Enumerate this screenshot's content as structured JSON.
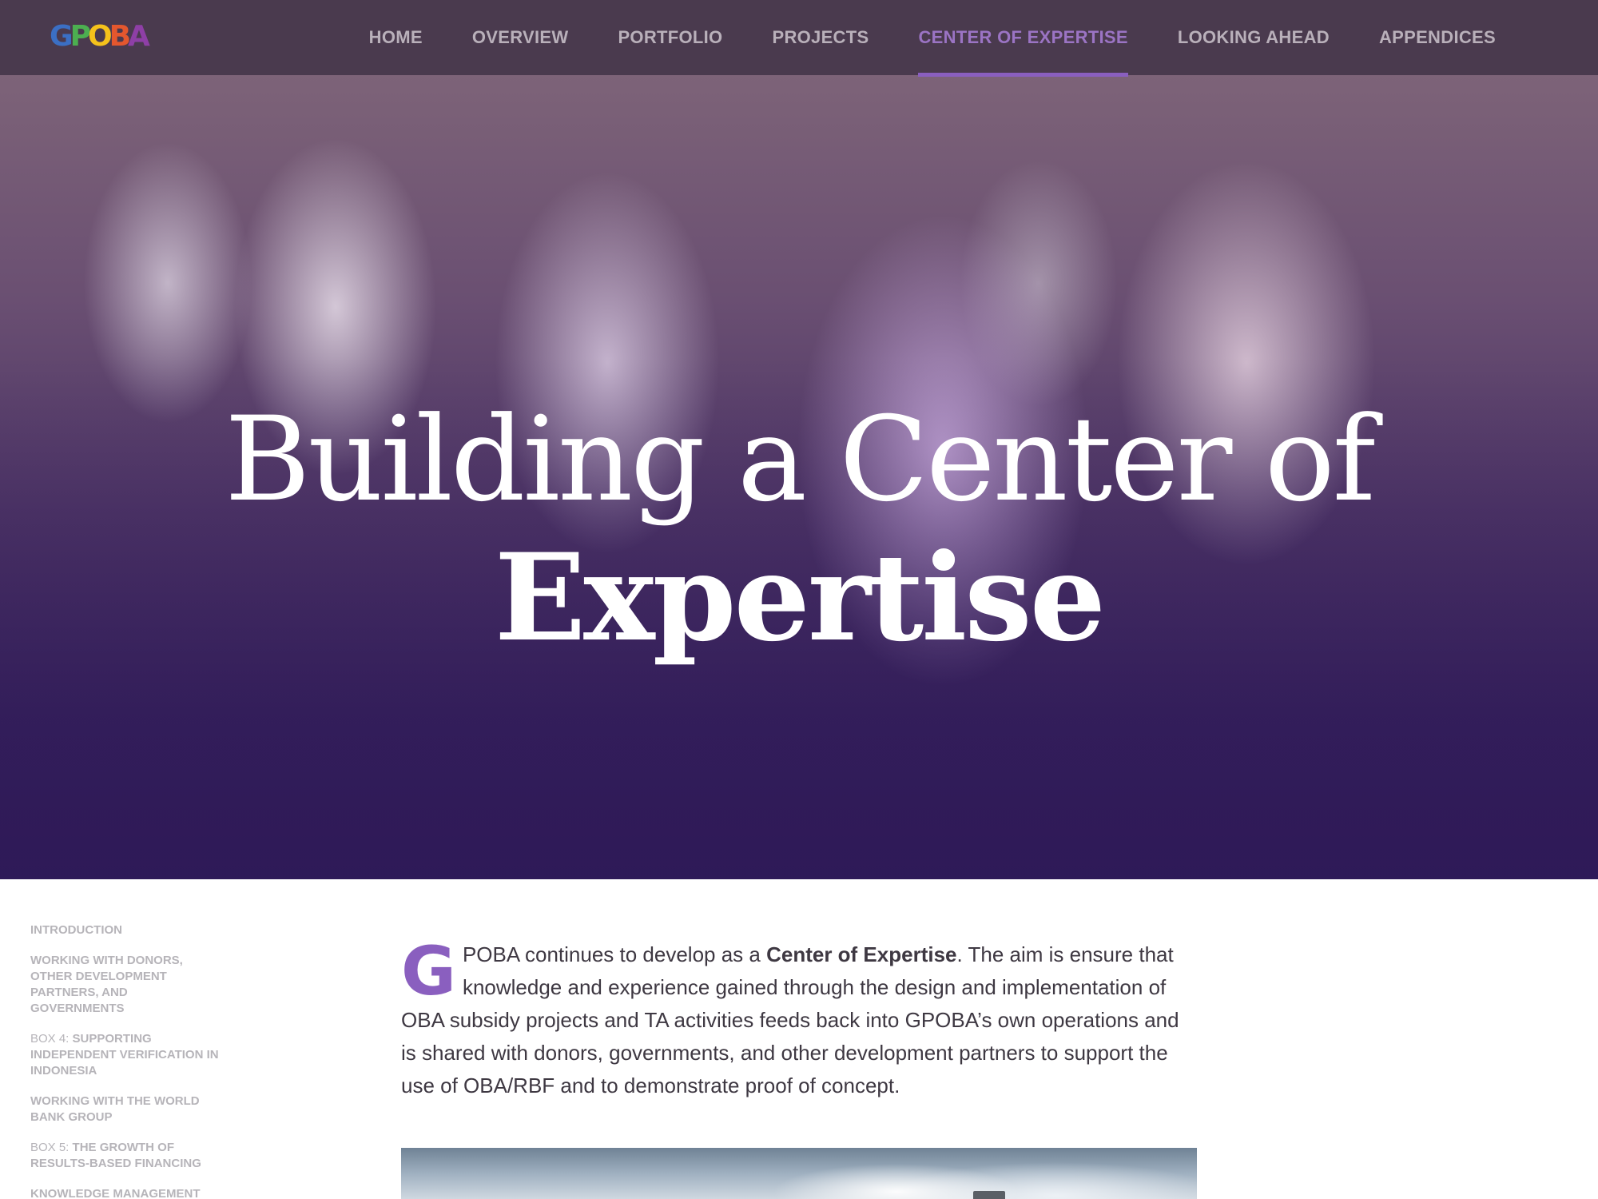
{
  "nav": {
    "logo_text": "GPOBA",
    "logo_letters": [
      {
        "char": "G",
        "color": "#3b6fc4"
      },
      {
        "char": "P",
        "color": "#4caf50"
      },
      {
        "char": "O",
        "color": "#f5c21b"
      },
      {
        "char": "B",
        "color": "#e4572e"
      },
      {
        "char": "A",
        "color": "#8e3fa6"
      }
    ],
    "items": [
      {
        "label": "HOME"
      },
      {
        "label": "OVERVIEW"
      },
      {
        "label": "PORTFOLIO"
      },
      {
        "label": "PROJECTS"
      },
      {
        "label": "CENTER OF EXPERTISE",
        "active": true
      },
      {
        "label": "LOOKING AHEAD"
      },
      {
        "label": "APPENDICES"
      }
    ],
    "active_color": "#8a5fbf"
  },
  "hero": {
    "title_line1": "Building a Center of",
    "title_line2": "Expertise"
  },
  "sidebar": {
    "items": [
      {
        "prefix": "",
        "label": "INTRODUCTION"
      },
      {
        "prefix": "",
        "label": "WORKING WITH DONORS, OTHER DEVELOPMENT PARTNERS, AND GOVERNMENTS"
      },
      {
        "prefix": "BOX 4: ",
        "label": "SUPPORTING INDEPENDENT VERIFICATION IN INDONESIA"
      },
      {
        "prefix": "",
        "label": "WORKING WITH THE WORLD BANK GROUP"
      },
      {
        "prefix": "BOX 5: ",
        "label": "THE GROWTH OF RESULTS-BASED FINANCING"
      },
      {
        "prefix": "",
        "label": "KNOWLEDGE MANAGEMENT"
      }
    ]
  },
  "intro": {
    "dropcap": "G",
    "text_before": "POBA continues to develop as a ",
    "strong": "Center of Expertise",
    "text_after": ". The aim is ensure that knowledge and experience gained through the design and implementation of OBA subsidy projects and TA activities feeds back into GPOBA’s own operations and is shared with donors, governments, and other development partners to support the use of OBA/RBF and to demonstrate proof of concept."
  }
}
